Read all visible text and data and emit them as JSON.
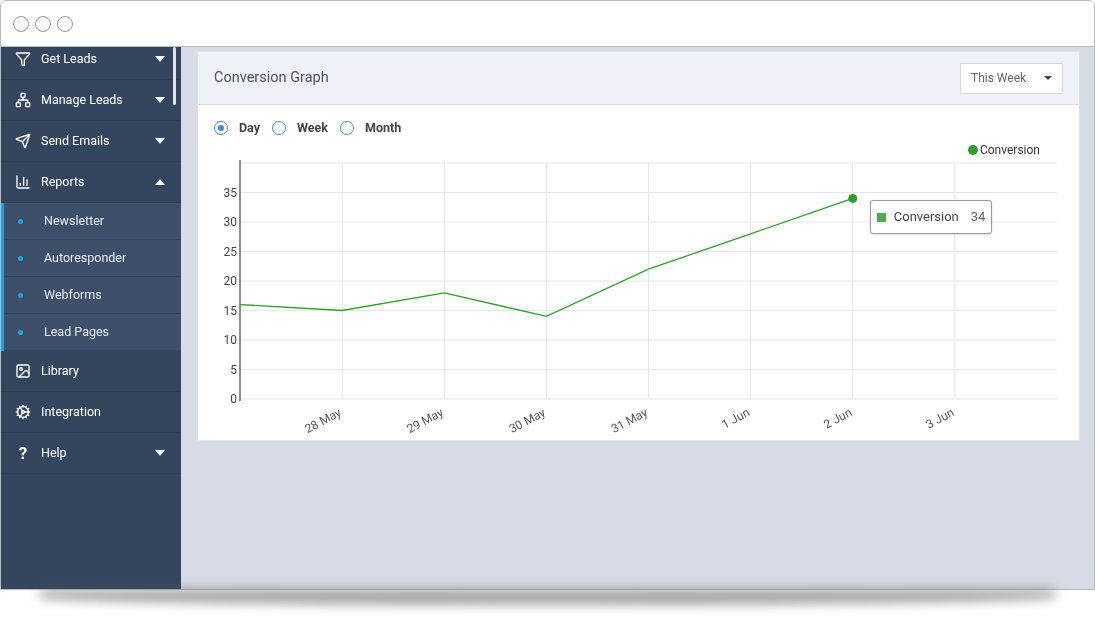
{
  "sidebar": {
    "items": [
      {
        "label": "Get Leads",
        "expandable": true,
        "expanded": false
      },
      {
        "label": "Manage Leads",
        "expandable": true,
        "expanded": false
      },
      {
        "label": "Send Emails",
        "expandable": true,
        "expanded": false
      },
      {
        "label": "Reports",
        "expandable": true,
        "expanded": true,
        "children": [
          {
            "label": "Newsletter"
          },
          {
            "label": "Autoresponder"
          },
          {
            "label": "Webforms"
          },
          {
            "label": "Lead Pages"
          }
        ]
      },
      {
        "label": "Library",
        "expandable": false
      },
      {
        "label": "Integration",
        "expandable": false
      },
      {
        "label": "Help",
        "glyph": "?",
        "expandable": true,
        "expanded": false
      }
    ]
  },
  "card": {
    "title": "Conversion Graph",
    "period": "This Week",
    "radios": [
      {
        "label": "Day",
        "selected": true
      },
      {
        "label": "Week",
        "selected": false
      },
      {
        "label": "Month",
        "selected": false
      }
    ],
    "chart_data": {
      "type": "line",
      "categories": [
        null,
        "28 May",
        "29 May",
        "30 May",
        "31 May",
        "1 Jun",
        "2 Jun",
        "3 Jun"
      ],
      "series": [
        {
          "name": "Conversion",
          "color": "#2ca02c",
          "values": [
            16,
            15,
            18,
            14,
            22,
            28,
            34,
            null
          ]
        }
      ],
      "ylim": [
        0,
        40
      ],
      "grid": true,
      "yticks": [
        0,
        5,
        10,
        15,
        20,
        25,
        30,
        35
      ]
    },
    "tooltip": {
      "label": "Conversion",
      "value": "34"
    }
  }
}
